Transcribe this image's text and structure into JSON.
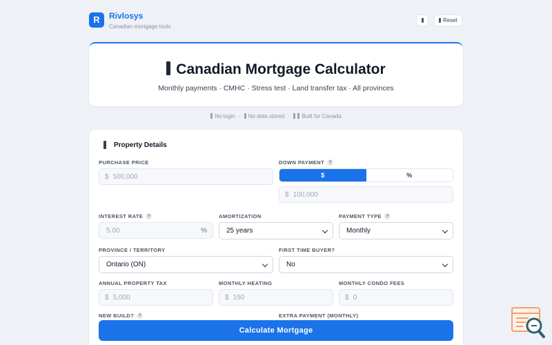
{
  "header": {
    "logo_letter": "R",
    "brand": "Rivlosys",
    "tagline": "Canadian mortgage tools",
    "reset_label": "Reset"
  },
  "hero": {
    "title": "Canadian Mortgage Calculator",
    "subtitle": "Monthly payments · CMHC · Stress test · Land transfer tax · All provinces"
  },
  "trust": {
    "items": [
      "No login",
      "No data stored",
      "Built for Canada"
    ]
  },
  "form": {
    "section_title": "Property Details",
    "purchase_price": {
      "label": "PURCHASE PRICE",
      "prefix": "$",
      "placeholder": "500,000"
    },
    "down_payment": {
      "label": "DOWN PAYMENT",
      "help": "?",
      "toggle": [
        "$",
        "%"
      ],
      "toggle_selected": "$",
      "prefix": "$",
      "placeholder": "100,000"
    },
    "interest_rate": {
      "label": "INTEREST RATE",
      "help": "?",
      "placeholder": "5.00",
      "suffix": "%"
    },
    "amortization": {
      "label": "AMORTIZATION",
      "value": "25 years"
    },
    "payment_type": {
      "label": "PAYMENT TYPE",
      "help": "?",
      "value": "Monthly"
    },
    "province": {
      "label": "PROVINCE / TERRITORY",
      "value": "Ontario (ON)"
    },
    "first_time_buyer": {
      "label": "FIRST TIME BUYER?",
      "value": "No"
    },
    "property_tax": {
      "label": "ANNUAL PROPERTY TAX",
      "prefix": "$",
      "placeholder": "5,000"
    },
    "heating": {
      "label": "MONTHLY HEATING",
      "prefix": "$",
      "placeholder": "150"
    },
    "condo_fees": {
      "label": "MONTHLY CONDO FEES",
      "prefix": "$",
      "placeholder": "0"
    },
    "new_build": {
      "label": "NEW BUILD?",
      "help": "?"
    },
    "extra_payment": {
      "label": "EXTRA PAYMENT (MONTHLY)"
    },
    "calculate_label": "Calculate Mortgage"
  },
  "colors": {
    "accent": "#1a73e8",
    "background": "#eef1f6",
    "widget_orange": "#f0a070"
  }
}
